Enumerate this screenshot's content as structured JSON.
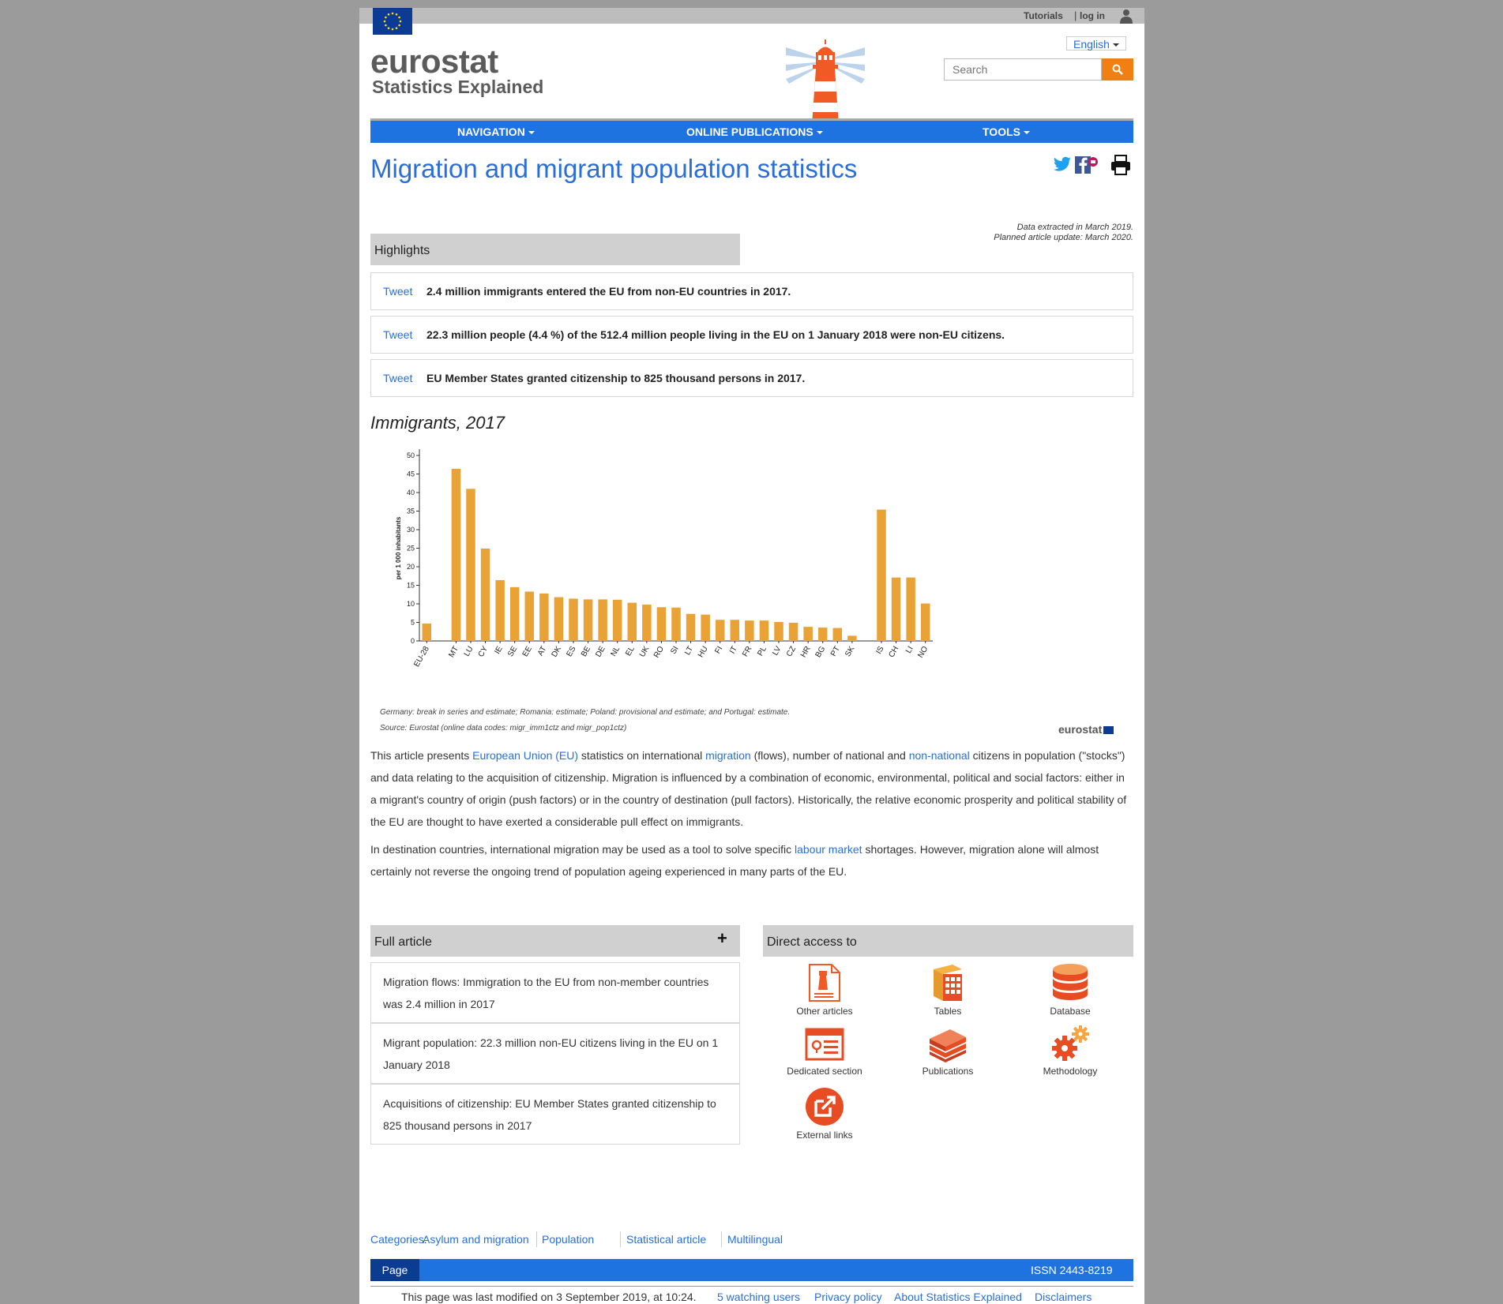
{
  "header": {
    "tutorials": "Tutorials",
    "login": "log in",
    "login_sep": "|",
    "logo_main": "eurostat",
    "logo_sub": "Statistics Explained",
    "language": "English",
    "search_placeholder": "Search"
  },
  "nav": {
    "items": [
      {
        "label": "NAVIGATION"
      },
      {
        "label": "ONLINE PUBLICATIONS"
      },
      {
        "label": "TOOLS"
      }
    ]
  },
  "article": {
    "title": "Migration and migrant population statistics",
    "data_extracted": "Data extracted in March 2019.",
    "planned_update": "Planned article update: March 2020."
  },
  "highlights": {
    "heading": "Highlights",
    "tweet_label": "Tweet",
    "items": [
      {
        "text": "2.4 million immigrants entered the EU from non-EU countries in 2017."
      },
      {
        "text": "22.3 million people (4.4 %) of the 512.4 million people living in the EU on 1 January 2018 were non-EU citizens."
      },
      {
        "text": "EU Member States granted citizenship to 825 thousand persons in 2017."
      }
    ]
  },
  "chart_data": {
    "type": "bar",
    "title": "Immigrants, 2017",
    "ylabel": "per 1 000 inhabitants",
    "xlabel": "",
    "ylim": [
      0,
      50
    ],
    "yticks": [
      0,
      5,
      10,
      15,
      20,
      25,
      30,
      35,
      40,
      45,
      50
    ],
    "categories": [
      "EU-28",
      "",
      "MT",
      "LU",
      "CY",
      "IE",
      "SE",
      "EE",
      "AT",
      "DK",
      "ES",
      "BE",
      "DE",
      "NL",
      "EL",
      "UK",
      "RO",
      "SI",
      "LT",
      "HU",
      "FI",
      "IT",
      "FR",
      "PL",
      "LV",
      "CZ",
      "HR",
      "BG",
      "PT",
      "SK",
      "",
      "IS",
      "CH",
      "LI",
      "NO"
    ],
    "values": [
      4.7,
      null,
      46.4,
      41.0,
      24.9,
      16.4,
      14.5,
      13.3,
      12.8,
      11.8,
      11.4,
      11.2,
      11.2,
      11.1,
      10.3,
      9.8,
      9.1,
      9.0,
      7.3,
      7.1,
      5.7,
      5.7,
      5.5,
      5.5,
      5.1,
      4.9,
      3.8,
      3.6,
      3.5,
      1.4,
      null,
      35.4,
      17.1,
      17.1,
      10.1
    ],
    "bar_color": "#e8a235",
    "grid": false,
    "notes": "Germany: break in series and estimate; Romania: estimate; Poland: provisional and estimate; and Portugal: estimate.",
    "source": "Source: Eurostat (online data codes: migr_imm1ctz and migr_pop1ctz)",
    "logo": "eurostat"
  },
  "intro": {
    "p1": {
      "t1": "This article presents ",
      "l1": "European Union (EU)",
      "t2": " statistics on international ",
      "l2": "migration",
      "t3": " (flows), number of national and ",
      "l3": "non-national",
      "t4": " citizens in population (\"stocks\") and data relating to the acquisition of citizenship. Migration is influenced by a combination of economic, environmental, political and social factors: either in a migrant's country of origin (push factors) or in the country of destination (pull factors). Historically, the relative economic prosperity and political stability of the EU are thought to have exerted a considerable pull effect on immigrants."
    },
    "p2": {
      "t1": "In destination countries, international migration may be used as a tool to solve specific ",
      "l1": "labour market",
      "t2": " shortages. However, migration alone will almost certainly not reverse the ongoing trend of population ageing experienced in many parts of the EU."
    }
  },
  "full_article": {
    "heading": "Full article",
    "toggle": "+",
    "items": [
      {
        "text": "Migration flows: Immigration to the EU from non-member countries was 2.4 million in 2017"
      },
      {
        "text": "Migrant population: 22.3 million non-EU citizens living in the EU on 1 January 2018"
      },
      {
        "text": "Acquisitions of citizenship: EU Member States granted citizenship to 825 thousand persons in 2017"
      }
    ]
  },
  "direct_access": {
    "heading": "Direct access to",
    "items": [
      {
        "label": "Other articles",
        "icon": "other-articles-icon"
      },
      {
        "label": "Tables",
        "icon": "tables-icon"
      },
      {
        "label": "Database",
        "icon": "database-icon"
      },
      {
        "label": "Dedicated section",
        "icon": "dedicated-section-icon"
      },
      {
        "label": "Publications",
        "icon": "publications-icon"
      },
      {
        "label": "Methodology",
        "icon": "methodology-icon"
      },
      {
        "label": "External links",
        "icon": "external-links-icon"
      }
    ]
  },
  "footer": {
    "categories_label": "Categories",
    "categories_colon": ":",
    "categories": [
      "Asylum and migration",
      "Population",
      "Statistical article",
      "Multilingual"
    ],
    "page_tab": "Page",
    "issn": "ISSN 2443-8219",
    "modified": "This page was last modified on 3 September 2019, at 10:24.",
    "links": [
      "5 watching users",
      "Privacy policy",
      "About Statistics Explained",
      "Disclaimers"
    ]
  },
  "colors": {
    "accent_blue": "#1f73e0",
    "link_blue": "#2a6ed8",
    "orange": "#f07f14",
    "bar": "#e8a235"
  }
}
